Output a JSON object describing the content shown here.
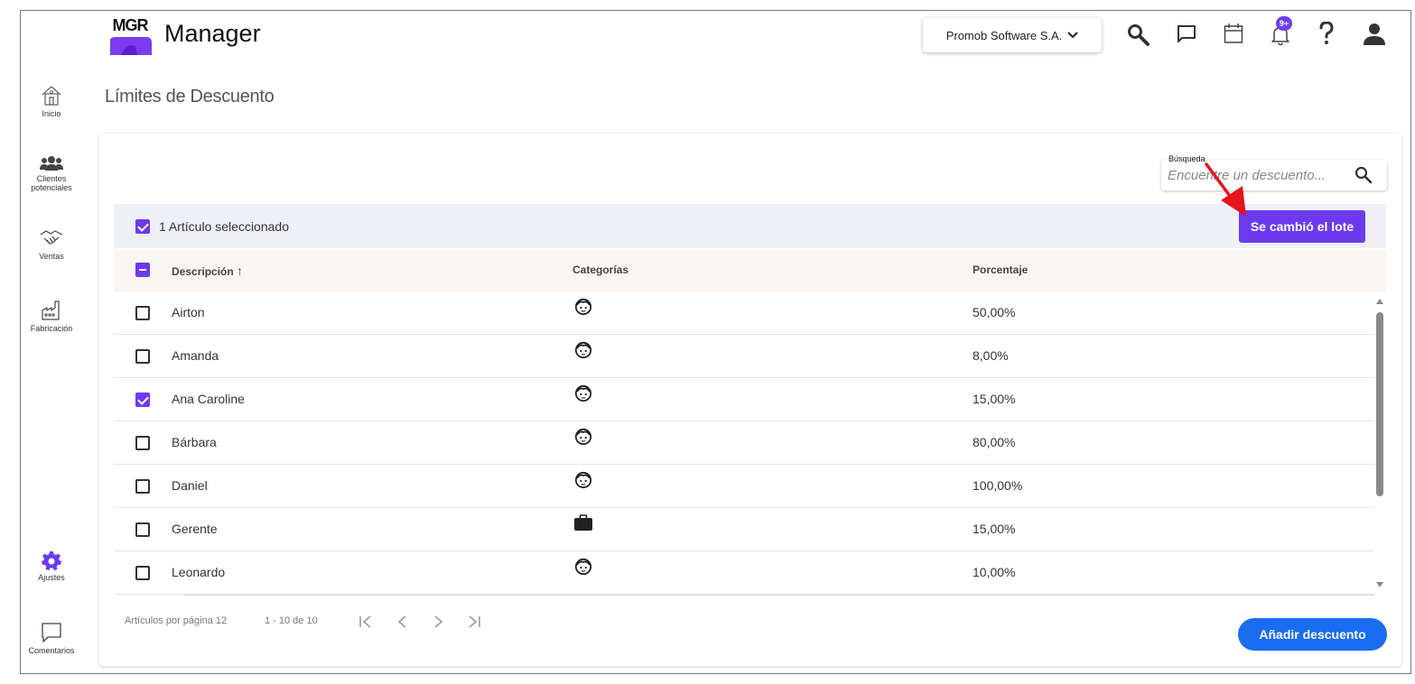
{
  "app": {
    "logo_text": "MGR",
    "title": "Manager",
    "company": "Promob Software S.A.",
    "notifications_badge": "9+",
    "brand_color": "#6b3aef",
    "accent_blue": "#1a6cf0"
  },
  "sidebar": {
    "items": [
      {
        "label": "Inicio",
        "icon": "home-icon"
      },
      {
        "label": "Clientes potenciales",
        "icon": "users-icon"
      },
      {
        "label": "Ventas",
        "icon": "handshake-icon"
      },
      {
        "label": "Fabricación",
        "icon": "factory-icon"
      },
      {
        "label": "Ajustes",
        "icon": "gear-icon"
      },
      {
        "label": "Comentarios",
        "icon": "comment-icon"
      }
    ]
  },
  "page": {
    "title": "Límites de Descuento"
  },
  "search": {
    "label": "Búsqueda",
    "placeholder": "Encuentre un descuento..."
  },
  "selection": {
    "text": "1 Artículo seleccionado",
    "batch_button": "Se cambió el lote"
  },
  "table": {
    "headers": [
      "Descripción",
      "Categorías",
      "Porcentaje"
    ],
    "sort_indicator": "↑",
    "rows": [
      {
        "name": "Airton",
        "category_icon": "face-icon",
        "percent": "50,00%",
        "checked": false
      },
      {
        "name": "Amanda",
        "category_icon": "face-icon",
        "percent": "8,00%",
        "checked": false
      },
      {
        "name": "Ana Caroline",
        "category_icon": "face-icon",
        "percent": "15,00%",
        "checked": true
      },
      {
        "name": "Bárbara",
        "category_icon": "face-icon",
        "percent": "80,00%",
        "checked": false
      },
      {
        "name": "Daniel",
        "category_icon": "face-icon",
        "percent": "100,00%",
        "checked": false
      },
      {
        "name": "Gerente",
        "category_icon": "briefcase-icon",
        "percent": "15,00%",
        "checked": false
      },
      {
        "name": "Leonardo",
        "category_icon": "face-icon",
        "percent": "10,00%",
        "checked": false
      }
    ]
  },
  "pagination": {
    "per_page_label": "Artículos por página 12",
    "range": "1 - 10 de 10"
  },
  "actions": {
    "add_button": "Añadir descuento"
  }
}
